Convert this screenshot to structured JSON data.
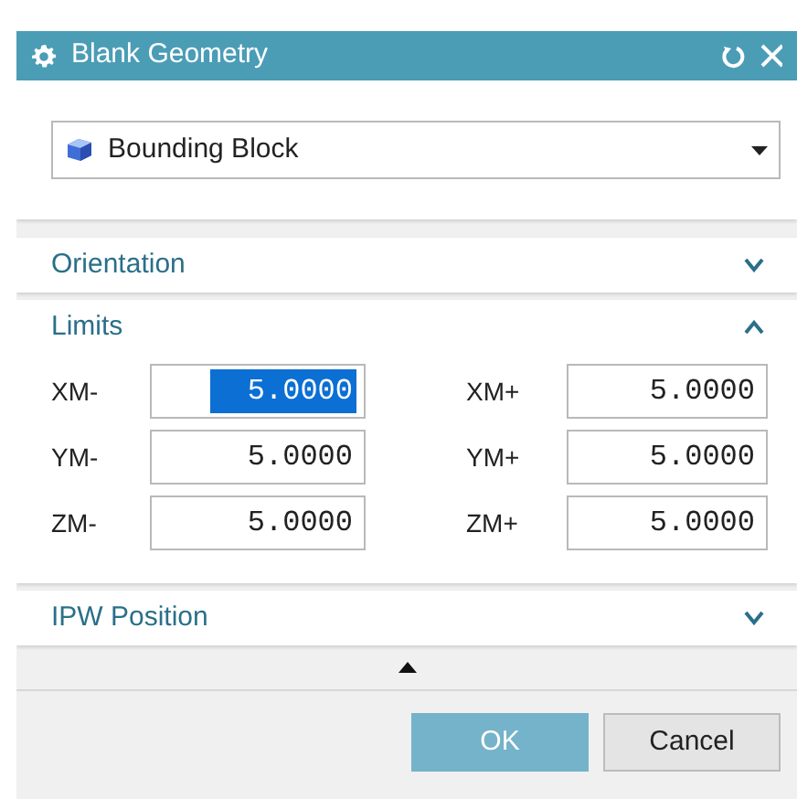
{
  "window": {
    "title": "Blank Geometry"
  },
  "type_dropdown": {
    "value": "Bounding Block"
  },
  "sections": [
    {
      "title": "Orientation",
      "expanded": false
    },
    {
      "title": "Limits",
      "expanded": true,
      "fields": [
        {
          "label": "XM-",
          "value": "5.0000",
          "text_selected": true
        },
        {
          "label": "XM+",
          "value": "5.0000",
          "text_selected": false
        },
        {
          "label": "YM-",
          "value": "5.0000",
          "text_selected": false
        },
        {
          "label": "YM+",
          "value": "5.0000",
          "text_selected": false
        },
        {
          "label": "ZM-",
          "value": "5.0000",
          "text_selected": false
        },
        {
          "label": "ZM+",
          "value": "5.0000",
          "text_selected": false
        }
      ]
    },
    {
      "title": "IPW Position",
      "expanded": false
    }
  ],
  "buttons": [
    {
      "label": "OK",
      "kind": "primary"
    },
    {
      "label": "Cancel",
      "kind": "secondary"
    }
  ]
}
